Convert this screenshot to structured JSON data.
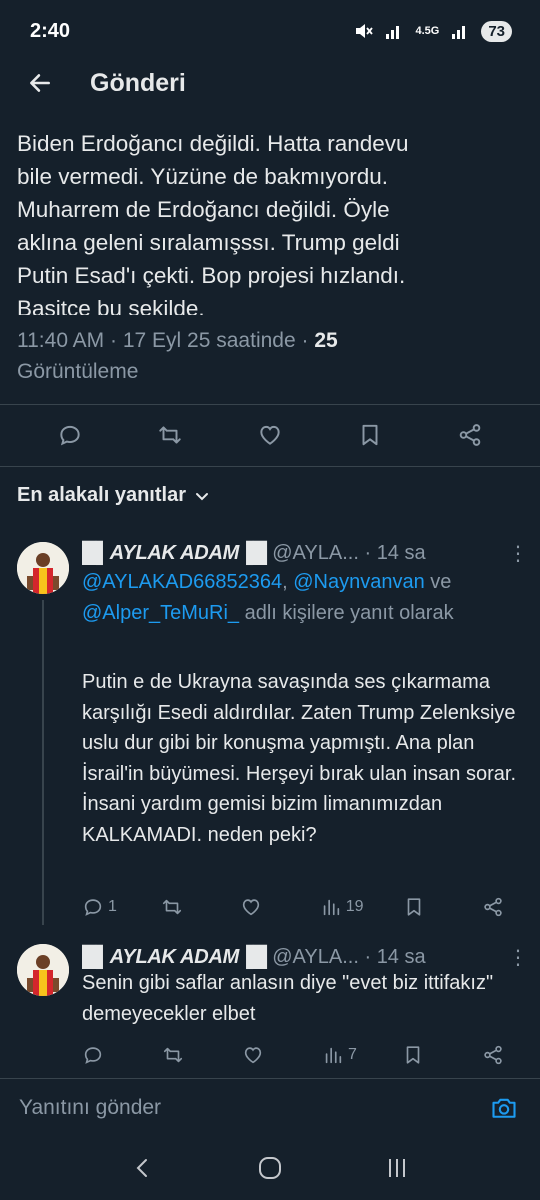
{
  "status_bar": {
    "time": "2:40",
    "network": "4.5G",
    "battery": "73"
  },
  "header": {
    "title": "Gönderi"
  },
  "tweet": {
    "text": "Biden Erdoğancı değildi. Hatta randevu\nbile vermedi. Yüzüne de bakmıyordu.\nMuharrem de Erdoğancı değildi. Öyle\naklına geleni sıralamışssı. Trump geldi\nPutin Esad'ı çekti. Bop projesi hızlandı.\nBasitçe bu şekilde.",
    "time": "11:40 AM",
    "sep1": "·",
    "date": "17 Eyl 25 saatinde",
    "sep2": "·",
    "views_count": "25",
    "views_label": "Görüntüleme"
  },
  "sort": {
    "label": "En alakalı yanıtlar"
  },
  "replies": [
    {
      "name": "█▌AYLAK ADAM▐█",
      "handle": "@AYLA...",
      "dot": "·",
      "time": "14 sa",
      "replying_mentions": [
        "@AYLAKAD66852364",
        "@Naynvanvan",
        "@Alper_TeMuRi_"
      ],
      "replying_sep1": ", ",
      "replying_ve": " ve ",
      "replying_suffix": " adlı kişilere yanıt olarak",
      "text": "Putin e de Ukrayna savaşında ses çıkarmama karşılığı Esedi aldırdılar. Zaten Trump Zelenksiye uslu dur gibi bir konuşma yapmıştı. Ana plan İsrail'in büyümesi. Herşeyi bırak ulan insan sorar. İnsani yardım gemisi bizim limanımızdan KALKAMADI. neden peki?",
      "reply_count": "1",
      "retweet_count": "",
      "like_count": "",
      "view_count": "19"
    },
    {
      "name": "█▌AYLAK ADAM▐█",
      "handle": "@AYLA...",
      "dot": "·",
      "time": "14 sa",
      "text": "Senin gibi saflar anlasın diye \"evet biz ittifakız\" demeyecekler elbet",
      "reply_count": "",
      "retweet_count": "",
      "like_count": "",
      "view_count": "7"
    }
  ],
  "compose": {
    "placeholder": "Yanıtını gönder"
  },
  "colors": {
    "background": "#15202b",
    "accent": "#1d9bf0",
    "muted": "#8b98a5",
    "text": "#e7e9ea"
  }
}
